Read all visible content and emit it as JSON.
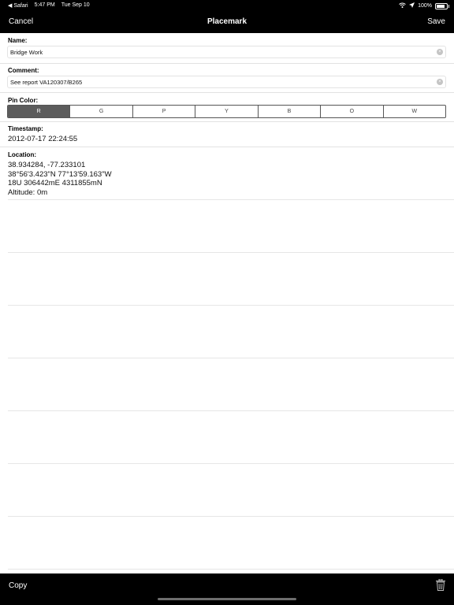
{
  "status_bar": {
    "back_app": "◀ Safari",
    "time": "5:47 PM",
    "date": "Tue Sep 10",
    "battery_text": "100%",
    "battery_level": 1.0
  },
  "nav": {
    "cancel_label": "Cancel",
    "title": "Placemark",
    "save_label": "Save"
  },
  "form": {
    "name_label": "Name:",
    "name_value": "Bridge Work",
    "comment_label": "Comment:",
    "comment_value": "See report VA120307/B265",
    "pin_color_label": "Pin Color:",
    "pin_colors": [
      "R",
      "G",
      "P",
      "Y",
      "B",
      "O",
      "W"
    ],
    "pin_color_selected": "R",
    "timestamp_label": "Timestamp:",
    "timestamp_value": "2012-07-17 22:24:55",
    "location_label": "Location:",
    "location_lines": [
      "38.934284, -77.233101",
      "38°56'3.423\"N 77°13'59.163\"W",
      "18U 306442mE 4311855mN",
      "Altitude: 0m"
    ]
  },
  "toolbar": {
    "copy_label": "Copy",
    "trash_icon": "trash-icon"
  }
}
